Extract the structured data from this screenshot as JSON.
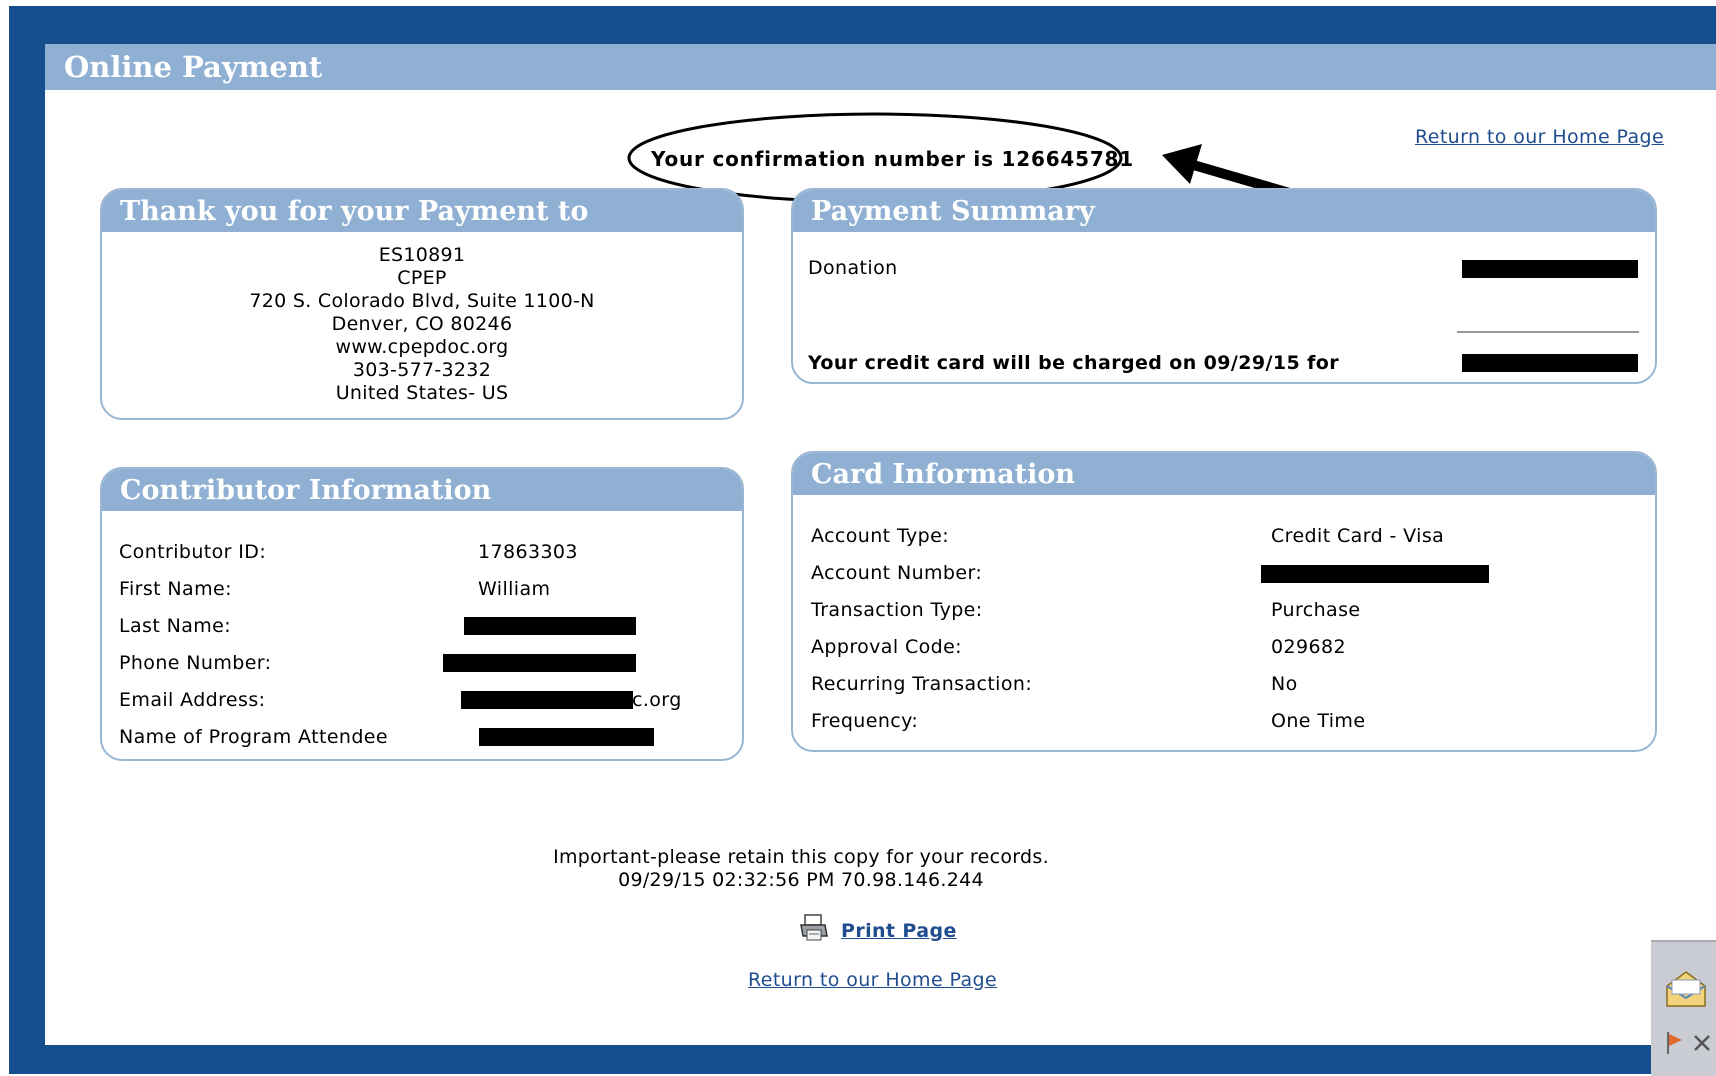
{
  "window": {
    "title": "Online Payment"
  },
  "top_link": "Return to our Home Page",
  "confirmation": "Your confirmation number is 126645781",
  "payee": {
    "heading": "Thank you for your Payment to",
    "lines": [
      "ES10891",
      "CPEP",
      "720 S. Colorado Blvd, Suite 1100-N",
      "Denver, CO 80246",
      "www.cpepdoc.org",
      "303-577-3232",
      "United States- US"
    ]
  },
  "summary": {
    "heading": "Payment Summary",
    "item_label": "Donation",
    "charge_text": "Your credit card will be charged on 09/29/15 for"
  },
  "contributor": {
    "heading": "Contributor Information",
    "rows": [
      {
        "label": "Contributor ID:",
        "value": "17863303"
      },
      {
        "label": "First Name:",
        "value": "William"
      },
      {
        "label": "Last Name:",
        "value": ""
      },
      {
        "label": "Phone Number:",
        "value": ""
      },
      {
        "label": "Email Address:",
        "value": "c.org"
      },
      {
        "label": "Name of Program Attendee",
        "value": ""
      }
    ]
  },
  "card": {
    "heading": "Card Information",
    "rows": [
      {
        "label": "Account Type:",
        "value": "Credit Card - Visa"
      },
      {
        "label": "Account Number:",
        "value": ""
      },
      {
        "label": "Transaction Type:",
        "value": "Purchase"
      },
      {
        "label": "Approval Code:",
        "value": "029682"
      },
      {
        "label": "Recurring Transaction:",
        "value": "No"
      },
      {
        "label": "Frequency:",
        "value": "One Time"
      }
    ]
  },
  "footer": {
    "notice": "Important-please retain this copy for your records.",
    "stamp": "09/29/15 02:32:56 PM 70.98.146.244",
    "print_label": "Print Page",
    "home_link": "Return to our Home Page"
  },
  "icons": {
    "print": "printer-icon",
    "mail": "envelope-icon",
    "flag": "flag-icon",
    "close": "close-icon"
  }
}
